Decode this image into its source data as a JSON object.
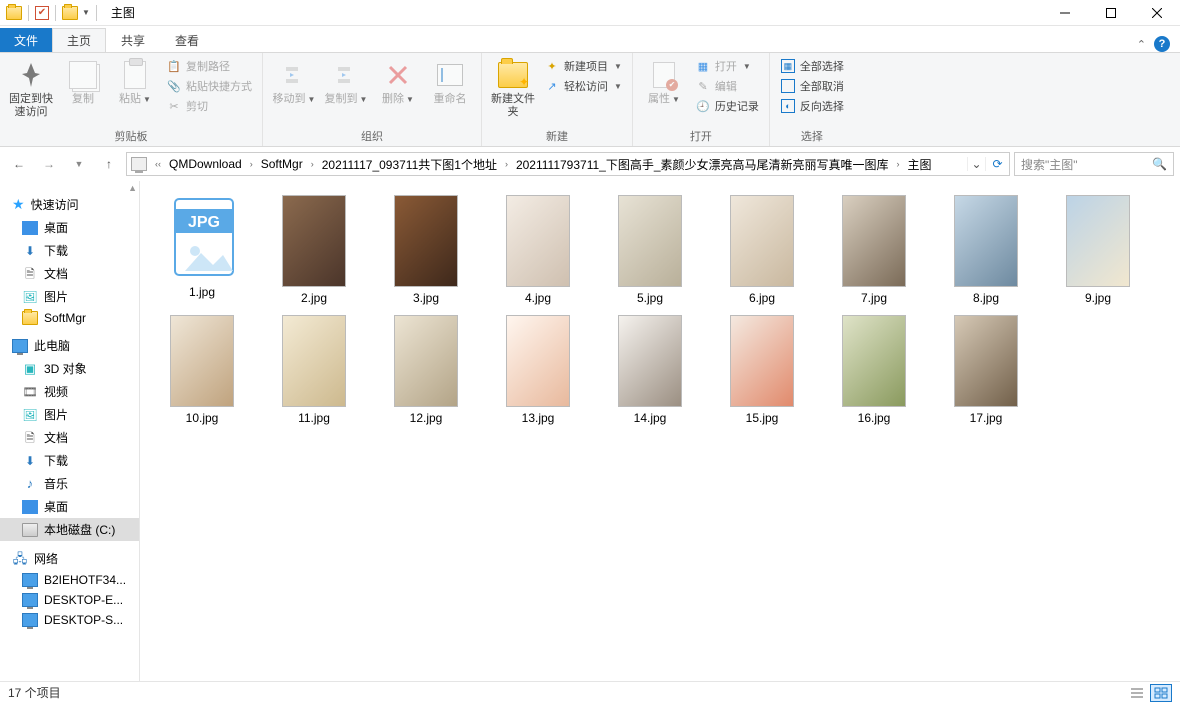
{
  "window": {
    "title": "主图",
    "qat_dropdown": "▾"
  },
  "tabs": {
    "file": "文件",
    "home": "主页",
    "share": "共享",
    "view": "查看"
  },
  "ribbon": {
    "clipboard": {
      "pin": "固定到快速访问",
      "copy": "复制",
      "paste": "粘贴",
      "copy_path": "复制路径",
      "paste_shortcut": "粘贴快捷方式",
      "cut": "剪切",
      "group": "剪贴板"
    },
    "organize": {
      "move_to": "移动到",
      "copy_to": "复制到",
      "delete": "删除",
      "rename": "重命名",
      "group": "组织"
    },
    "new": {
      "new_folder": "新建文件夹",
      "new_item": "新建项目",
      "easy_access": "轻松访问",
      "group": "新建"
    },
    "open": {
      "properties": "属性",
      "open": "打开",
      "edit": "编辑",
      "history": "历史记录",
      "group": "打开"
    },
    "select": {
      "select_all": "全部选择",
      "select_none": "全部取消",
      "invert": "反向选择",
      "group": "选择"
    }
  },
  "address": {
    "segments": [
      "QMDownload",
      "SoftMgr",
      "20211117_093711共下图1个地址",
      "2021111793711_下图高手_素颜少女漂亮高马尾清新亮丽写真唯一图库",
      "主图"
    ]
  },
  "search": {
    "placeholder": "搜索\"主图\""
  },
  "sidebar": {
    "quick_access": "快速访问",
    "desktop": "桌面",
    "downloads": "下载",
    "documents": "文档",
    "pictures": "图片",
    "softmgr": "SoftMgr",
    "this_pc": "此电脑",
    "objects3d": "3D 对象",
    "videos": "视频",
    "pictures2": "图片",
    "documents2": "文档",
    "downloads2": "下载",
    "music": "音乐",
    "desktop2": "桌面",
    "local_disk": "本地磁盘 (C:)",
    "network": "网络",
    "pc1": "B2IEHOTF34...",
    "pc2": "DESKTOP-E...",
    "pc3": "DESKTOP-S..."
  },
  "files": [
    {
      "name": "1.jpg",
      "badge": true
    },
    {
      "name": "2.jpg",
      "cls": "p2"
    },
    {
      "name": "3.jpg",
      "cls": "p3"
    },
    {
      "name": "4.jpg",
      "cls": "p4"
    },
    {
      "name": "5.jpg",
      "cls": "p5"
    },
    {
      "name": "6.jpg",
      "cls": "p6"
    },
    {
      "name": "7.jpg",
      "cls": "p7"
    },
    {
      "name": "8.jpg",
      "cls": "p8"
    },
    {
      "name": "9.jpg",
      "cls": "p9"
    },
    {
      "name": "10.jpg",
      "cls": "p10"
    },
    {
      "name": "11.jpg",
      "cls": "p11"
    },
    {
      "name": "12.jpg",
      "cls": "p12"
    },
    {
      "name": "13.jpg",
      "cls": "p13"
    },
    {
      "name": "14.jpg",
      "cls": "p14"
    },
    {
      "name": "15.jpg",
      "cls": "p15"
    },
    {
      "name": "16.jpg",
      "cls": "p16"
    },
    {
      "name": "17.jpg",
      "cls": "p17"
    }
  ],
  "status": {
    "count": "17 个项目"
  }
}
